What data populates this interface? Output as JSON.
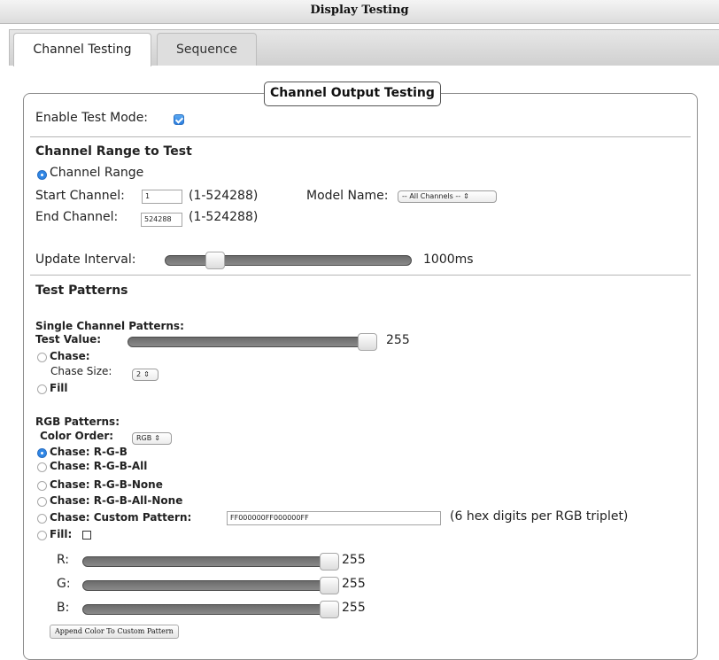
{
  "window": {
    "title": "Display Testing"
  },
  "tabs": [
    {
      "label": "Channel Testing",
      "active": true
    },
    {
      "label": "Sequence",
      "active": false
    }
  ],
  "panel": {
    "legend": "Channel Output Testing",
    "test_mode": {
      "label": "Enable Test Mode:",
      "checked": true
    },
    "channel_range": {
      "heading": "Channel Range to Test",
      "radio_label": "Channel Range",
      "start_label": "Start Channel:",
      "start_value": "1",
      "start_hint": "(1-524288)",
      "end_label": "End Channel:",
      "end_value": "524288",
      "end_hint": "(1-524288)",
      "model_label": "Model Name:",
      "model_value": "-- All Channels --"
    },
    "update_interval": {
      "label": "Update Interval:",
      "value_text": "1000ms",
      "fraction": 0.18
    },
    "test_patterns": {
      "heading": "Test Patterns",
      "single": {
        "heading": "Single Channel Patterns:",
        "test_value_label": "Test Value:",
        "test_value": "255",
        "test_value_fraction": 1.0,
        "chase_label": "Chase:",
        "chase_size_label": "Chase Size:",
        "chase_size_value": "2",
        "fill_label": "Fill"
      },
      "rgb": {
        "heading": "RGB Patterns:",
        "color_order_label": "Color Order:",
        "color_order_value": "RGB",
        "options": [
          {
            "label": "Chase: R-G-B",
            "selected": true
          },
          {
            "label": "Chase: R-G-B-All",
            "selected": false
          },
          {
            "label": "Chase: R-G-B-None",
            "selected": false
          },
          {
            "label": "Chase: R-G-B-All-None",
            "selected": false
          },
          {
            "label": "Chase: Custom Pattern:",
            "selected": false
          },
          {
            "label": "Fill:",
            "selected": false
          }
        ],
        "custom_pattern_value": "FF000000FF000000FF",
        "custom_pattern_hint": "(6 hex digits per RGB triplet)",
        "sliders": [
          {
            "label": "R:",
            "value": "255",
            "fraction": 1.0
          },
          {
            "label": "G:",
            "value": "255",
            "fraction": 1.0
          },
          {
            "label": "B:",
            "value": "255",
            "fraction": 1.0
          }
        ],
        "append_button": "Append Color To Custom Pattern"
      }
    }
  }
}
